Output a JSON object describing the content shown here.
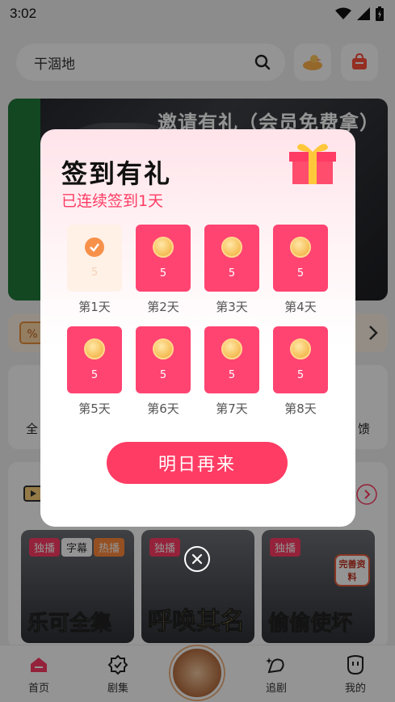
{
  "status": {
    "time": "3:02"
  },
  "search": {
    "text": "干涸地"
  },
  "banner": {
    "title": "邀请有礼（会员免费拿）"
  },
  "side_labels": {
    "left": "全",
    "right": "馈"
  },
  "dramas": [
    {
      "tags": [
        "独播",
        "字幕",
        "热播"
      ],
      "title": "乐可全集"
    },
    {
      "tags": [
        "独播"
      ],
      "title": "呼唤其名"
    },
    {
      "tags": [
        "独播"
      ],
      "title": "偷偷使坏",
      "badge": "完善资料"
    }
  ],
  "tabbar": {
    "items": [
      {
        "label": "首页"
      },
      {
        "label": "剧集"
      },
      {
        "label": "追剧"
      },
      {
        "label": "我的"
      }
    ]
  },
  "modal": {
    "title": "签到有礼",
    "subtitle": "已连续签到1天",
    "days": [
      {
        "label": "第1天",
        "reward": "5",
        "checked": true
      },
      {
        "label": "第2天",
        "reward": "5",
        "checked": false
      },
      {
        "label": "第3天",
        "reward": "5",
        "checked": false
      },
      {
        "label": "第4天",
        "reward": "5",
        "checked": false
      },
      {
        "label": "第5天",
        "reward": "5",
        "checked": false
      },
      {
        "label": "第6天",
        "reward": "5",
        "checked": false
      },
      {
        "label": "第7天",
        "reward": "5",
        "checked": false
      },
      {
        "label": "第8天",
        "reward": "5",
        "checked": false
      }
    ],
    "button_label": "明日再来"
  },
  "colors": {
    "accent": "#ff3c64",
    "card": "#ff4472",
    "coin": "#f7c25f"
  }
}
